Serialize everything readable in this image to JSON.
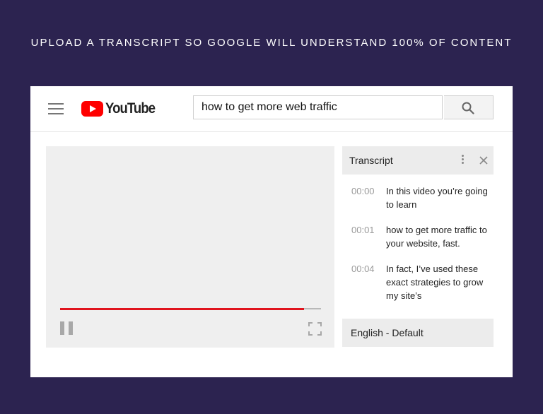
{
  "headline": "UPLOAD A TRANSCRIPT SO GOOGLE WILL UNDERSTAND 100% OF CONTENT",
  "header": {
    "logo_text": "YouTube",
    "search_value": "how to get more web traffic"
  },
  "player": {
    "progress": 0.935
  },
  "transcript": {
    "title": "Transcript",
    "lines": [
      {
        "time": "00:00",
        "text": "In this video you’re going to learn"
      },
      {
        "time": "00:01",
        "text": "how to get more traffic to your website, fast."
      },
      {
        "time": "00:04",
        "text": "In fact, I’ve used these exact strategies to grow my site’s"
      }
    ],
    "language": "English - Default"
  },
  "colors": {
    "background": "#2c2350",
    "accent_red": "#e0141e"
  }
}
